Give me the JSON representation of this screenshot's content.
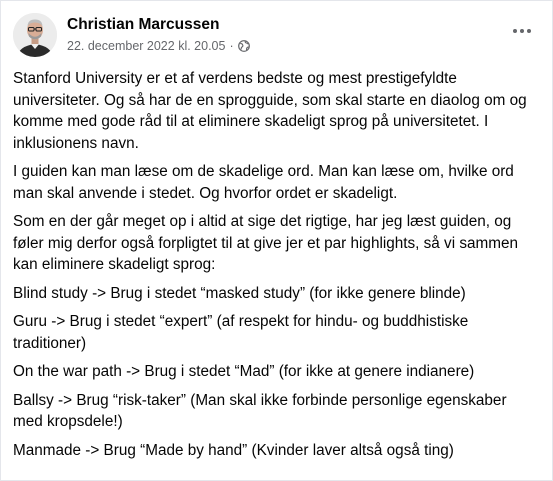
{
  "post": {
    "author": "Christian Marcussen",
    "timestamp": "22. december 2022 kl. 20.05",
    "separator": "·",
    "privacy_icon": "globe-icon",
    "more_icon": "more-horizontal-icon",
    "paragraphs": [
      "Stanford University er et af verdens bedste og mest prestigefyldte universiteter. Og så har de en sprogguide, som skal starte en diaolog om og komme med gode råd til at eliminere skadeligt sprog på universitetet. I inklusionens navn.",
      "I guiden kan man læse om de skadelige ord. Man kan læse om, hvilke ord man skal anvende i stedet. Og hvorfor ordet er skadeligt.",
      "Som en der går meget op i altid at sige det rigtige, har jeg læst guiden, og føler mig derfor også forpligtet til at give jer et par highlights, så vi sammen kan eliminere skadeligt sprog:",
      "Blind study -> Brug i stedet “masked study” (for ikke genere blinde)",
      "Guru -> Brug i stedet “expert” (af respekt for hindu- og buddhistiske traditioner)",
      "On the war path -> Brug i stedet “Mad” (for ikke at genere indianere)",
      "Ballsy -> Brug “risk-taker” (Man skal ikke forbinde personlige egenskaber med kropsdele!)",
      "Manmade -> Brug “Made by hand” (Kvinder laver altså også ting)"
    ]
  }
}
